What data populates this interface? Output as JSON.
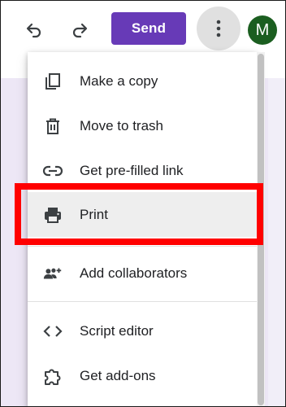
{
  "toolbar": {
    "undo_icon": "undo-icon",
    "redo_icon": "redo-icon",
    "send_label": "Send",
    "more_icon": "more-vert-icon",
    "avatar_initial": "M"
  },
  "colors": {
    "send_bg": "#673ab7",
    "avatar_bg": "#1b5e20",
    "highlight_border": "#ff0000",
    "page_bg": "#ede7f6"
  },
  "menu": {
    "items": [
      {
        "label": "Make a copy",
        "icon": "copy-icon"
      },
      {
        "label": "Move to trash",
        "icon": "trash-icon"
      },
      {
        "label": "Get pre-filled link",
        "icon": "link-icon"
      },
      {
        "label": "Print",
        "icon": "print-icon",
        "highlighted": true
      },
      {
        "label": "Add collaborators",
        "icon": "add-people-icon"
      },
      {
        "label": "Script editor",
        "icon": "code-icon"
      },
      {
        "label": "Get add-ons",
        "icon": "puzzle-icon"
      }
    ]
  }
}
